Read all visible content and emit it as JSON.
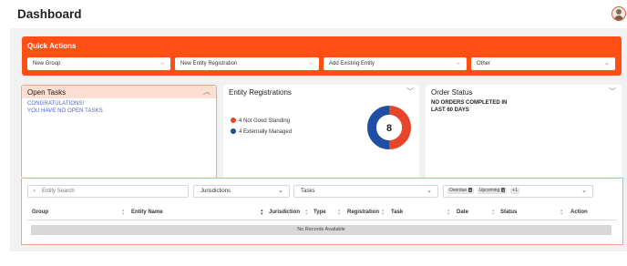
{
  "header": {
    "title": "Dashboard",
    "avatar_icon": "user-avatar-icon"
  },
  "quick_actions": {
    "title": "Quick Actions",
    "buttons": [
      {
        "label": "New Group",
        "icon": "arrow-right-icon"
      },
      {
        "label": "New Entity Registration",
        "icon": "arrow-right-icon"
      },
      {
        "label": "Add Existing Entity",
        "icon": "arrow-right-icon"
      }
    ],
    "other_select": {
      "value": "Other",
      "icon": "chevron-down-icon"
    },
    "color": "#ff4f14"
  },
  "open_tasks": {
    "title": "Open Tasks",
    "line1": "CONGRATULATIONS!",
    "line2": "YOU HAVE NO OPEN TASKS",
    "toggle_icon": "chevron-up-icon"
  },
  "entity_registrations": {
    "title": "Entity Registrations",
    "legend": [
      {
        "label": "4 Not Good Standing",
        "color": "#e8462a"
      },
      {
        "label": "4 Externally Managed",
        "color": "#1f4ea3"
      }
    ],
    "chart_data": {
      "type": "pie",
      "categories": [
        "Not Good Standing",
        "Externally Managed"
      ],
      "values": [
        4,
        4
      ],
      "center_label": "8"
    },
    "toggle_icon": "chevron-down-icon"
  },
  "order_status": {
    "title": "Order Status",
    "line1": "NO ORDERS COMPLETED IN",
    "line2": "LAST 60 DAYS",
    "toggle_icon": "chevron-down-icon"
  },
  "filters": {
    "search_placeholder": "Entity Search",
    "jurisdictions": "Jurisdictions",
    "tasks": "Tasks",
    "date_chips": [
      "Overdue",
      "Upcoming"
    ],
    "date_more": "+1"
  },
  "table": {
    "columns": [
      "Group",
      "Entity Name",
      "Jurisdiction",
      "Type",
      "Registration",
      "Task",
      "Date",
      "Status",
      "Action"
    ],
    "empty_text": "No Records Available"
  }
}
